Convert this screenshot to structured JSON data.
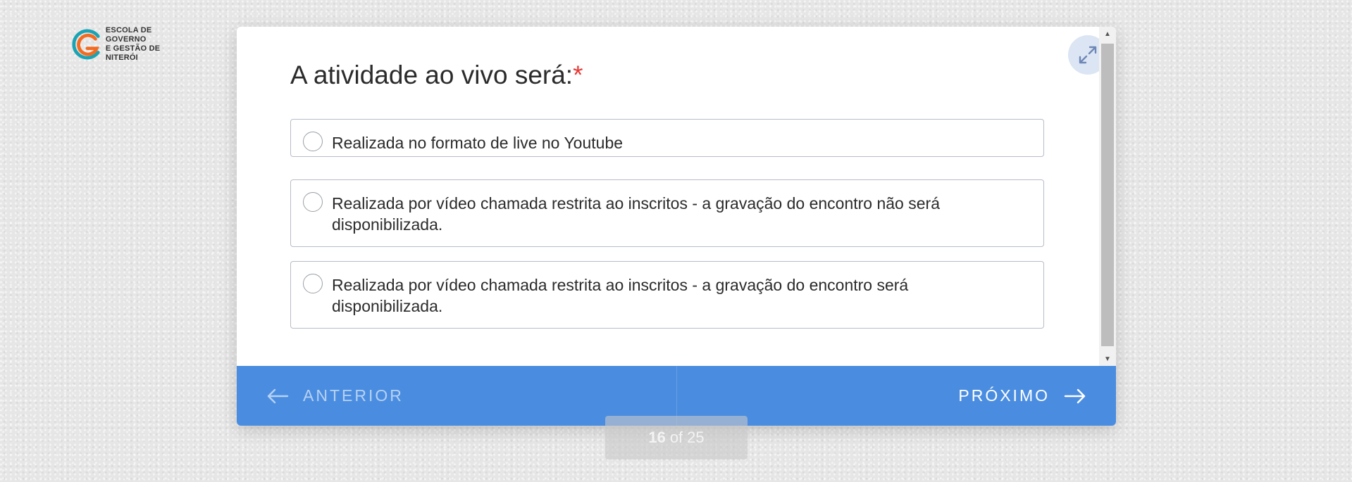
{
  "logo": {
    "line1": "ESCOLA DE GOVERNO",
    "line2": "E GESTÃO DE NITERÓI"
  },
  "question": {
    "title": "A atividade ao vivo será:",
    "required_mark": "*"
  },
  "options": [
    {
      "label": "Realizada no formato de live no Youtube"
    },
    {
      "label": "Realizada por vídeo chamada restrita ao inscritos - a gravação do encontro não será disponibilizada."
    },
    {
      "label": "Realizada por vídeo chamada restrita ao inscritos - a gravação do encontro será disponibilizada."
    }
  ],
  "nav": {
    "prev_label": "ANTERIOR",
    "next_label": "PRÓXIMO"
  },
  "pager": {
    "current": "16",
    "of": "of",
    "total": "25"
  },
  "colors": {
    "accent": "#4a8de0",
    "required": "#e53935",
    "logo_orange": "#f26b21",
    "logo_teal": "#1aa3b4"
  },
  "icons": {
    "expand": "expand-icon",
    "prev": "arrow-left-icon",
    "next": "arrow-right-icon"
  }
}
